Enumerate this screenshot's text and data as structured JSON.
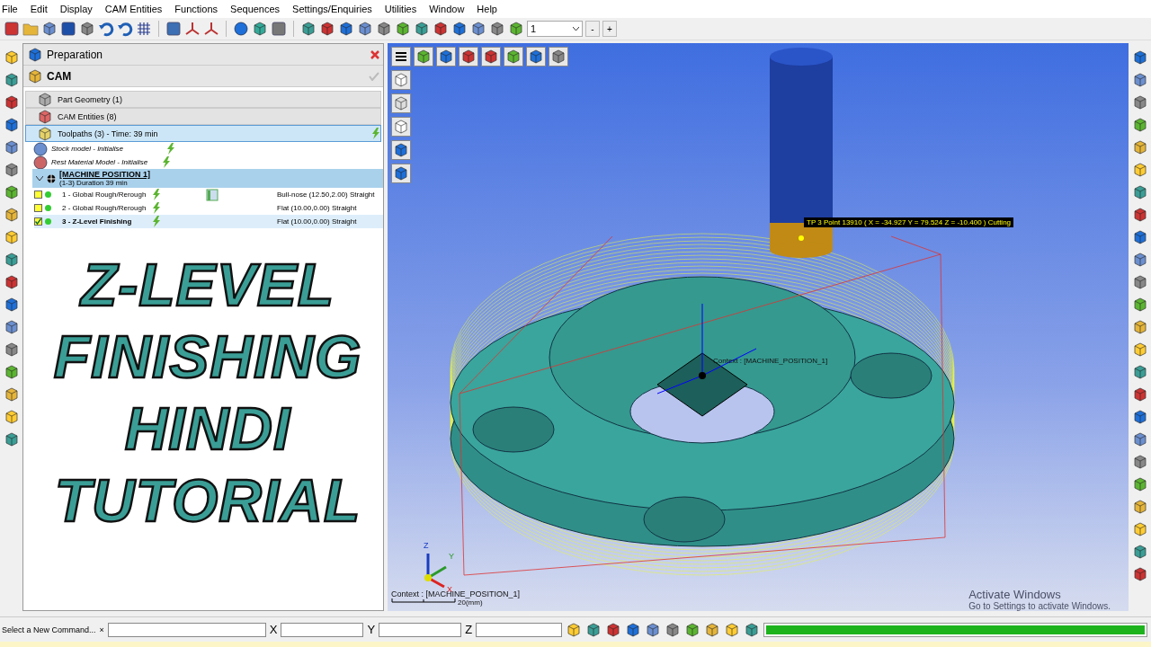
{
  "menu": [
    "File",
    "Edit",
    "Display",
    "CAM Entities",
    "Functions",
    "Sequences",
    "Settings/Enquiries",
    "Utilities",
    "Window",
    "Help"
  ],
  "toolbar": {
    "view_select": "1",
    "step_buttons": [
      "-",
      "+"
    ]
  },
  "panel": {
    "header": "Preparation",
    "section": "CAM",
    "groups": [
      "Part Geometry (1)",
      "CAM Entities (8)"
    ],
    "toolpaths": {
      "label": "Toolpaths (3) - Time: 39 min",
      "selected": true
    },
    "models": [
      "Stock model - Initialise",
      "Rest Material Model - Initialise"
    ],
    "machine": {
      "title": "[MACHINE POSITION 1]",
      "subtitle": "(1-3) Duration 39 min",
      "expanded": true
    },
    "rows": [
      {
        "name": "1 - Global Rough/Rerough",
        "tool": "Bull-nose (12.50,2.00) Straight",
        "checked": false,
        "selected": false,
        "color": "#33cc33"
      },
      {
        "name": "2 - Global Rough/Rerough",
        "tool": "Flat (10.00,0.00) Straight",
        "checked": false,
        "selected": false,
        "color": "#33cc33"
      },
      {
        "name": "3 - Z-Level Finishing",
        "tool": "Flat (10.00,0.00) Straight",
        "checked": true,
        "selected": true,
        "color": "#33cc33"
      }
    ]
  },
  "overlay_title": [
    "Z-LEVEL",
    "FINISHING",
    "HINDI",
    "TUTORIAL"
  ],
  "viewport": {
    "tooltip": "TP 3 Point 13910 ( X = -34.927  Y = 79.524  Z = -10.400 ) Cutting",
    "part_context": "Context : [MACHINE_POSITION_1]",
    "axis_labels": [
      "Z",
      "Y",
      "X"
    ],
    "context": "Context : [MACHINE_POSITION_1]",
    "scale": "20(mm)"
  },
  "os_notice": {
    "title": "Activate Windows",
    "text": "Go to Settings to activate Windows."
  },
  "status_bar": {
    "command_label": "Select a New Command...",
    "clear": "×",
    "coords": [
      "X",
      "Y",
      "Z"
    ],
    "progress": {
      "level": 1.0
    }
  }
}
